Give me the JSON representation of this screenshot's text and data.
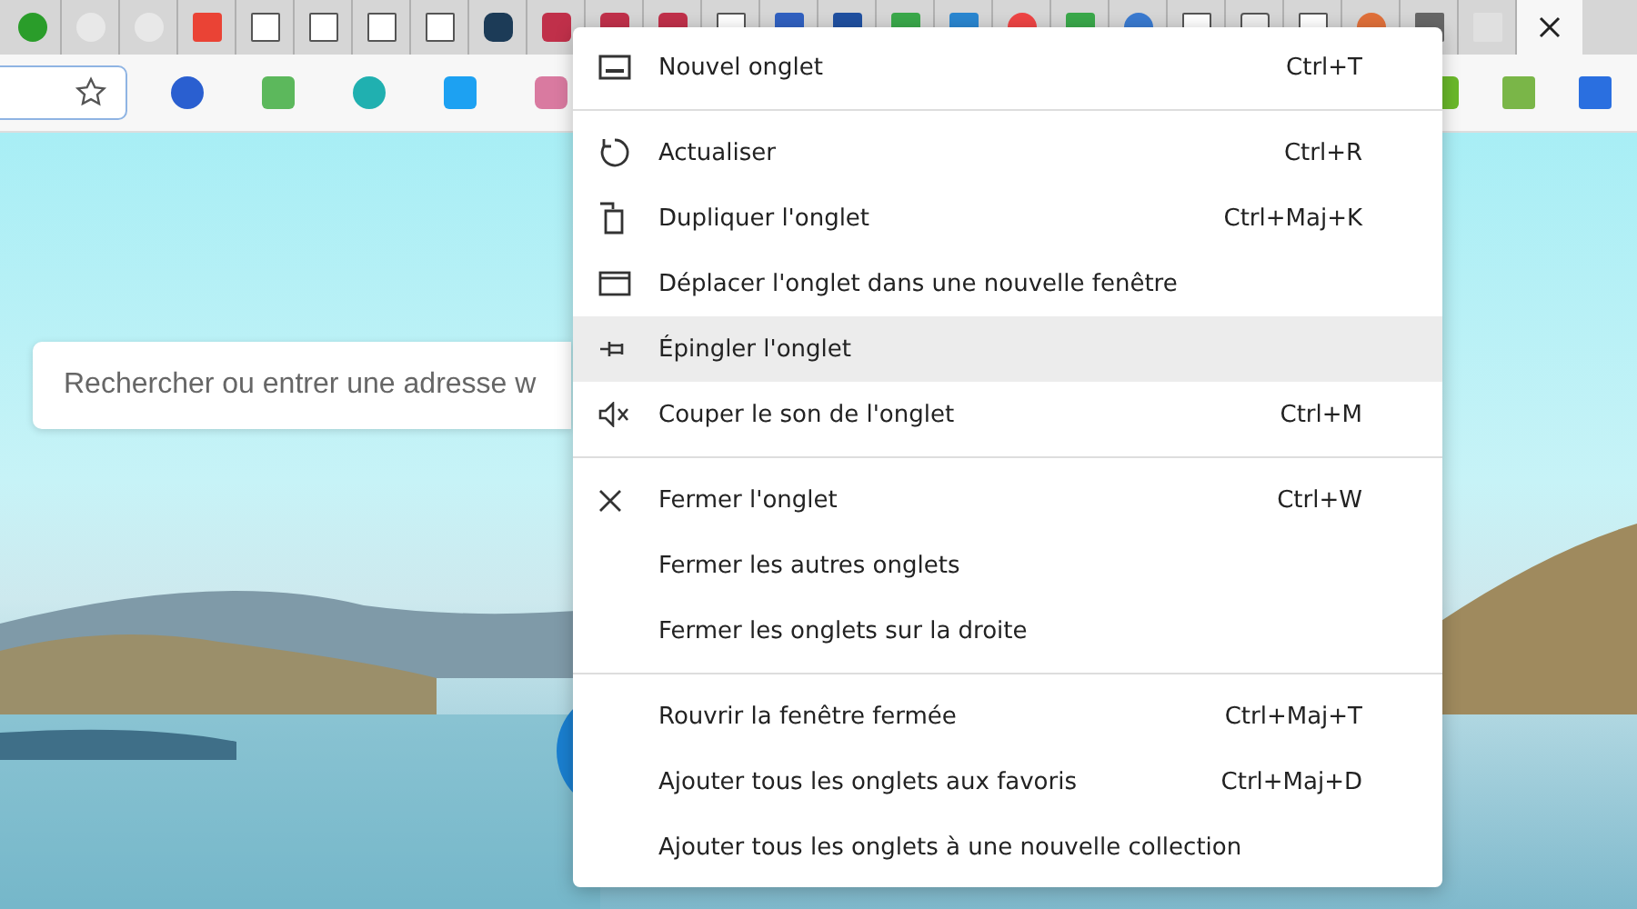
{
  "tab_strip": {
    "tabs": [
      {
        "selected": false
      },
      {
        "selected": false
      },
      {
        "selected": false
      },
      {
        "selected": false
      },
      {
        "selected": false
      },
      {
        "selected": false
      },
      {
        "selected": false
      },
      {
        "selected": false
      },
      {
        "selected": false
      },
      {
        "selected": false
      },
      {
        "selected": false
      },
      {
        "selected": false
      },
      {
        "selected": false
      },
      {
        "selected": false
      },
      {
        "selected": false
      },
      {
        "selected": false
      },
      {
        "selected": false
      },
      {
        "selected": false
      },
      {
        "selected": false
      },
      {
        "selected": false
      },
      {
        "selected": false
      },
      {
        "selected": false
      },
      {
        "selected": false
      },
      {
        "selected": false
      },
      {
        "selected": false
      },
      {
        "selected": false
      },
      {
        "selected": true
      }
    ]
  },
  "search": {
    "placeholder": "Rechercher ou entrer une adresse w"
  },
  "context_menu": {
    "sections": [
      [
        {
          "kind": "new-tab",
          "label": "Nouvel onglet",
          "shortcut": "Ctrl+T",
          "selected": false
        }
      ],
      [
        {
          "kind": "refresh",
          "label": "Actualiser",
          "shortcut": "Ctrl+R",
          "selected": false
        },
        {
          "kind": "duplicate",
          "label": "Dupliquer l'onglet",
          "shortcut": "Ctrl+Maj+K",
          "selected": false
        },
        {
          "kind": "window",
          "label": "Déplacer l'onglet dans une nouvelle fenêtre",
          "selected": false
        },
        {
          "kind": "pin",
          "label": "Épingler l'onglet",
          "selected": true
        },
        {
          "kind": "mute",
          "label": "Couper le son de l'onglet",
          "shortcut": "Ctrl+M",
          "selected": false
        }
      ],
      [
        {
          "kind": "close",
          "label": "Fermer l'onglet",
          "shortcut": "Ctrl+W",
          "selected": false
        },
        {
          "kind": "plain",
          "label": "Fermer les autres onglets",
          "selected": false
        },
        {
          "kind": "plain",
          "label": "Fermer les onglets sur la droite",
          "selected": false
        }
      ],
      [
        {
          "kind": "plain",
          "label": "Rouvrir la fenêtre fermée",
          "shortcut": "Ctrl+Maj+T",
          "selected": false
        },
        {
          "kind": "plain",
          "label": "Ajouter tous les onglets aux favoris",
          "shortcut": "Ctrl+Maj+D",
          "selected": false
        },
        {
          "kind": "plain",
          "label": "Ajouter tous les onglets à une nouvelle collection",
          "selected": false
        }
      ]
    ]
  }
}
